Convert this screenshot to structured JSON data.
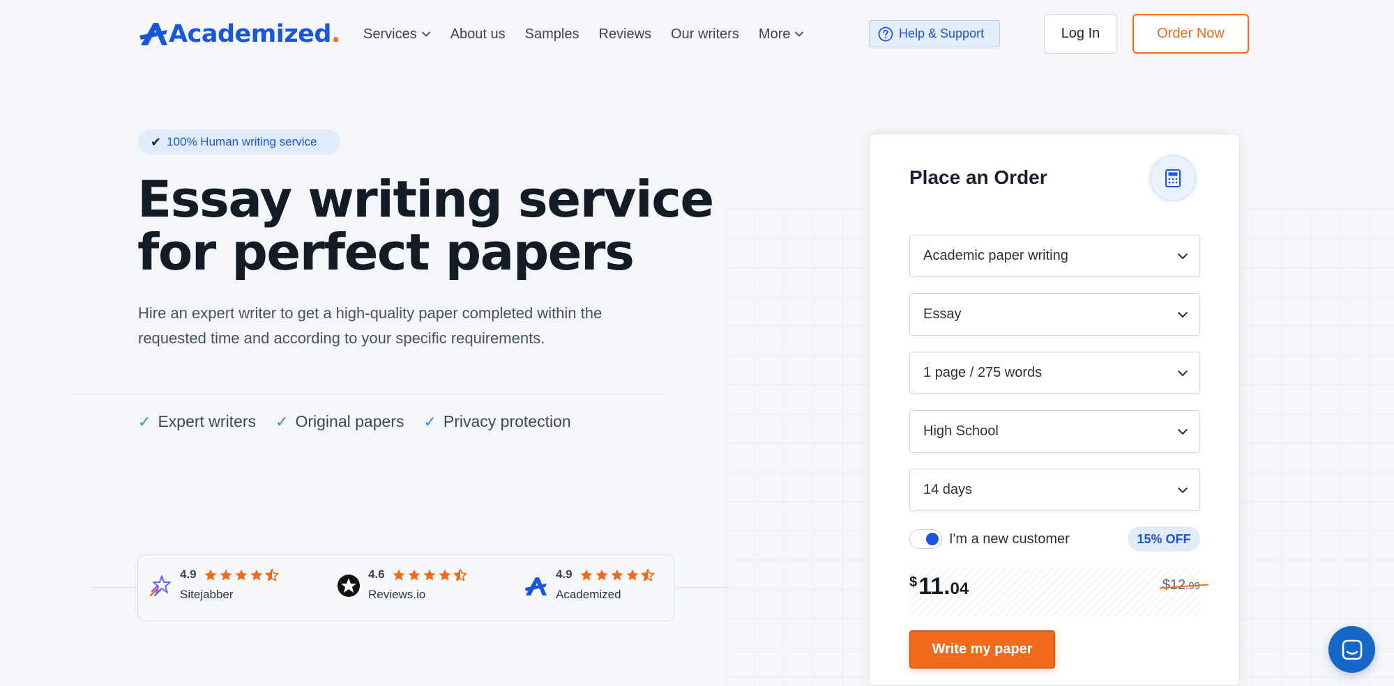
{
  "brand": {
    "name": "Academized",
    "accent": "#1a56db",
    "orange": "#f26a1b"
  },
  "nav": {
    "items": [
      {
        "label": "Services",
        "has_dropdown": true
      },
      {
        "label": "About us",
        "has_dropdown": false
      },
      {
        "label": "Samples",
        "has_dropdown": false
      },
      {
        "label": "Reviews",
        "has_dropdown": false
      },
      {
        "label": "Our writers",
        "has_dropdown": false
      },
      {
        "label": "More",
        "has_dropdown": true
      }
    ],
    "help_label": "Help & Support",
    "login_label": "Log In",
    "order_label": "Order Now"
  },
  "hero": {
    "badge": "100% Human writing service",
    "title_line1": "Essay writing service",
    "title_line2": "for perfect papers",
    "description": "Hire an expert writer to get a high-quality paper completed within the requested time and according to your specific requirements.",
    "features": [
      "Expert writers",
      "Original papers",
      "Privacy protection"
    ]
  },
  "ratings": [
    {
      "score": "4.9",
      "stars": 4.5,
      "name": "Sitejabber"
    },
    {
      "score": "4.6",
      "stars": 4.5,
      "name": "Reviews.io"
    },
    {
      "score": "4.9",
      "stars": 4.5,
      "name": "Academized"
    }
  ],
  "order": {
    "title": "Place an Order",
    "selects": [
      {
        "value": "Academic paper writing"
      },
      {
        "value": "Essay"
      },
      {
        "value": "1 page / 275 words"
      },
      {
        "value": "High School"
      },
      {
        "value": "14 days"
      }
    ],
    "new_customer_label": "I'm a new customer",
    "new_customer_on": true,
    "discount": "15% OFF",
    "price": {
      "currency": "$",
      "int": "11",
      "cents": "04"
    },
    "old_price": {
      "currency": "$",
      "int": "12",
      "cents": "99"
    },
    "submit_label": "Write my paper"
  }
}
